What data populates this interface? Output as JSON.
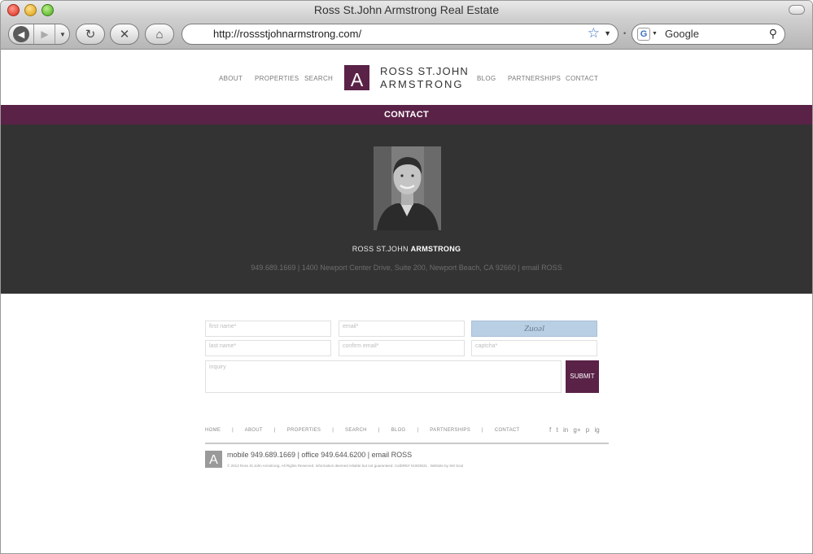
{
  "browser": {
    "window_title": "Ross St.John Armstrong Real Estate",
    "url": "http://rossstjohnarmstrong.com/",
    "search_placeholder": "Google",
    "search_engine_letter": "G"
  },
  "site": {
    "nav_left": [
      "ABOUT",
      "PROPERTIES",
      "SEARCH"
    ],
    "nav_right": [
      "BLOG",
      "PARTNERSHIPS",
      "CONTACT"
    ],
    "logo": {
      "letter": "A",
      "line1": "ROSS ST.JOHN",
      "line2": "ARMSTRONG"
    },
    "brand_color": "#5a2247"
  },
  "contact": {
    "band_title": "CONTACT",
    "agent_name_first": "ROSS ST.JOHN ",
    "agent_name_last": "ARMSTRONG",
    "info_line": "949.689.1669 | 1400 Newport Center Drive, Suite 200, Newport Beach, CA 92660 | email ROSS"
  },
  "form": {
    "first_name": "first name*",
    "email": "email*",
    "captcha_text": "Zuoəl",
    "last_name": "last name*",
    "confirm_email": "confirm email*",
    "captcha_field": "captcha*",
    "inquiry": "inquiry",
    "submit": "SUBMIT"
  },
  "footer": {
    "nav": [
      "HOME",
      "|",
      "ABOUT",
      "|",
      "PROPERTIES",
      "|",
      "SEARCH",
      "|",
      "BLOG",
      "|",
      "PARTNERSHIPS",
      "|",
      "CONTACT"
    ],
    "social": [
      "f",
      "t",
      "in",
      "g+",
      "p",
      "ig"
    ],
    "logo_letter": "A",
    "contact_line": "mobile 949.689.1669 | office 949.644.6200 | email ROSS",
    "legal": "© 2013 Ross St.John Armstrong. All Rights Reserved. Information deemed reliable but not guaranteed. CalDRE# 01903531 . Website by SM Soul"
  }
}
